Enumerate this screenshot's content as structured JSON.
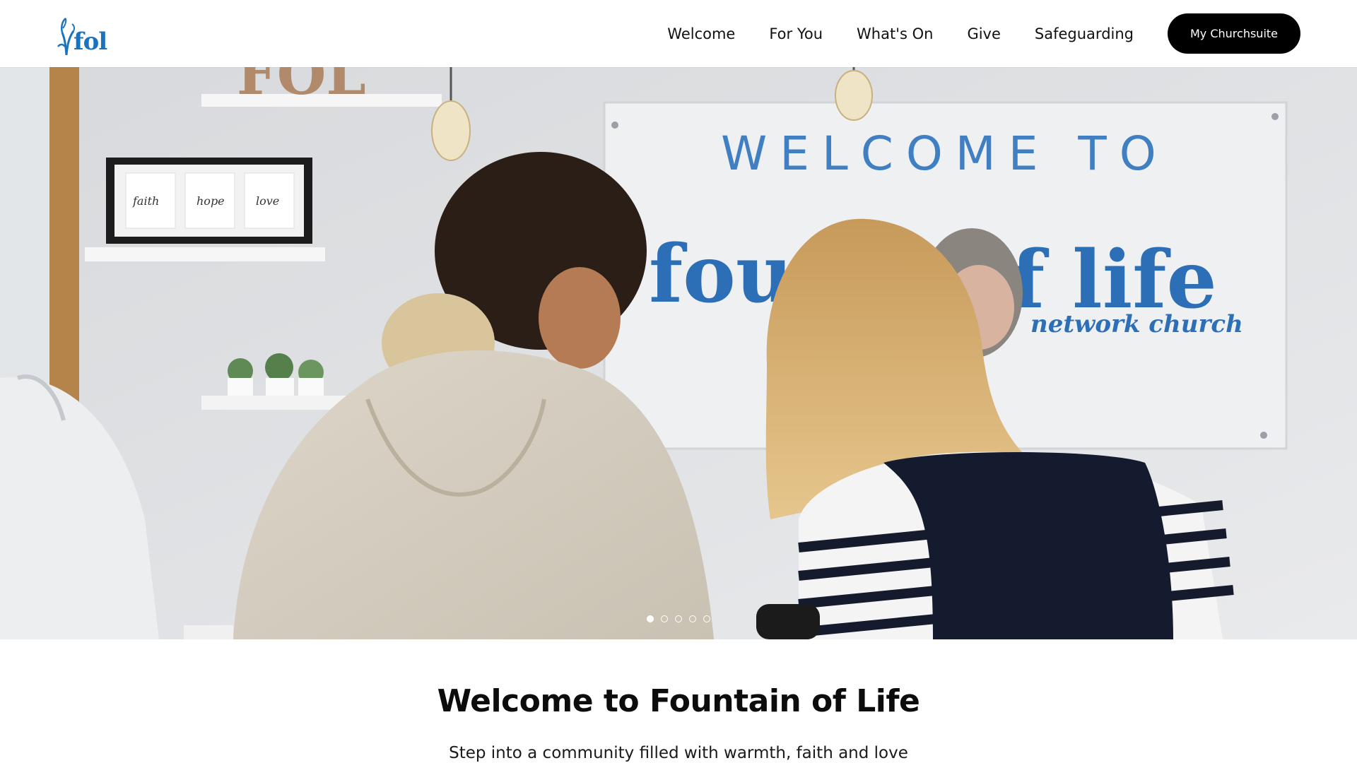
{
  "header": {
    "logo_text": "fol",
    "nav": [
      {
        "label": "Welcome"
      },
      {
        "label": "For You"
      },
      {
        "label": "What's On"
      },
      {
        "label": "Give"
      },
      {
        "label": "Safeguarding"
      }
    ],
    "cta_label": "My Churchsuite"
  },
  "hero": {
    "sign_line1": "WELCOME TO",
    "sign_line2a": "foun",
    "sign_line2b": "f life",
    "sign_line3": "network church",
    "frame_words": [
      "faith",
      "hope",
      "love"
    ],
    "shelf_letters": "FOL",
    "slides_total": 5,
    "active_slide": 1
  },
  "main": {
    "title": "Welcome to Fountain of Life",
    "subtitle": "Step into a community filled with warmth, faith and love"
  },
  "colors": {
    "brand_blue": "#1b74bb",
    "cta_bg": "#000000"
  },
  "icons": {
    "logo": "fountain-plant-logo"
  }
}
